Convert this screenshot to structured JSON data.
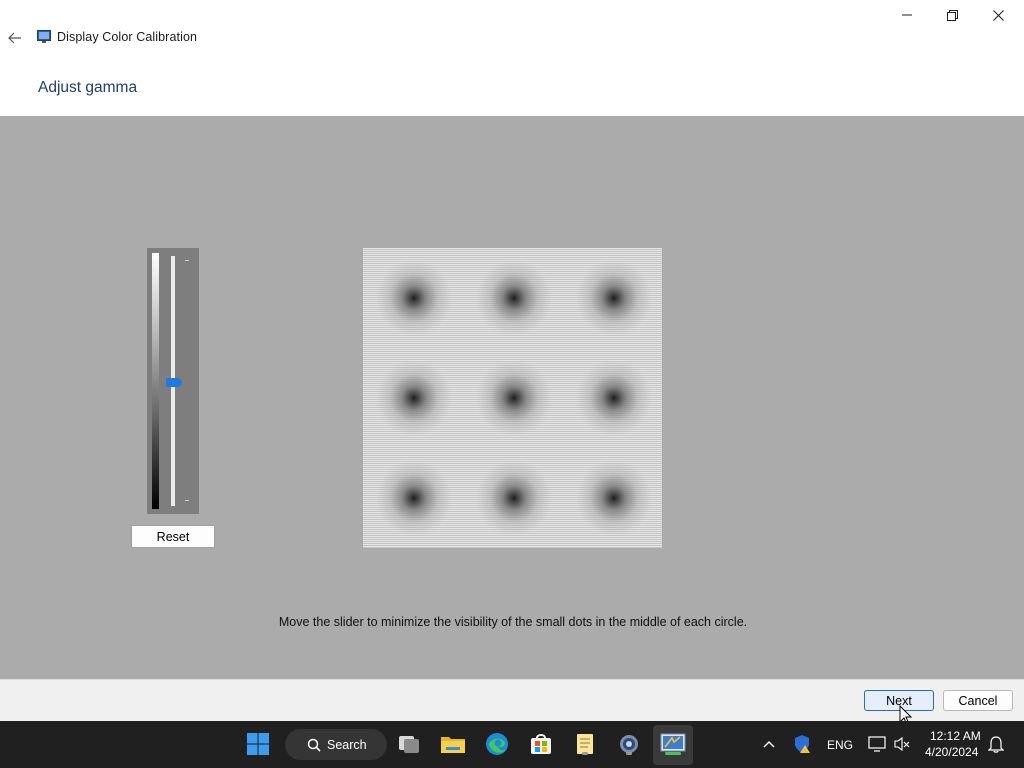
{
  "window": {
    "title": "Display Color Calibration",
    "controls": {
      "minimize": "minimize-icon",
      "maximize": "restore-icon",
      "close": "close-icon"
    }
  },
  "page": {
    "heading": "Adjust gamma",
    "instruction": "Move the slider to minimize the visibility of the small dots in the middle of each circle."
  },
  "gamma_slider": {
    "level_fraction": 0.47,
    "reset_label": "Reset"
  },
  "footer": {
    "next_label": "Next",
    "cancel_label": "Cancel"
  },
  "taskbar": {
    "search_label": "Search",
    "pinned": [
      "start-icon",
      "search-icon",
      "task-view-icon",
      "file-explorer-icon",
      "edge-icon",
      "store-icon",
      "notepad-icon",
      "settings-icon",
      "color-calibration-icon"
    ],
    "tray": {
      "language": "ENG",
      "time": "12:12 AM",
      "date": "4/20/2024"
    }
  },
  "colors": {
    "heading": "#1d3f74",
    "panel_bg": "#ababab",
    "slider_thumb": "#1f7ae0",
    "next_border": "#2a6ac8",
    "taskbar_bg": "#202020"
  }
}
